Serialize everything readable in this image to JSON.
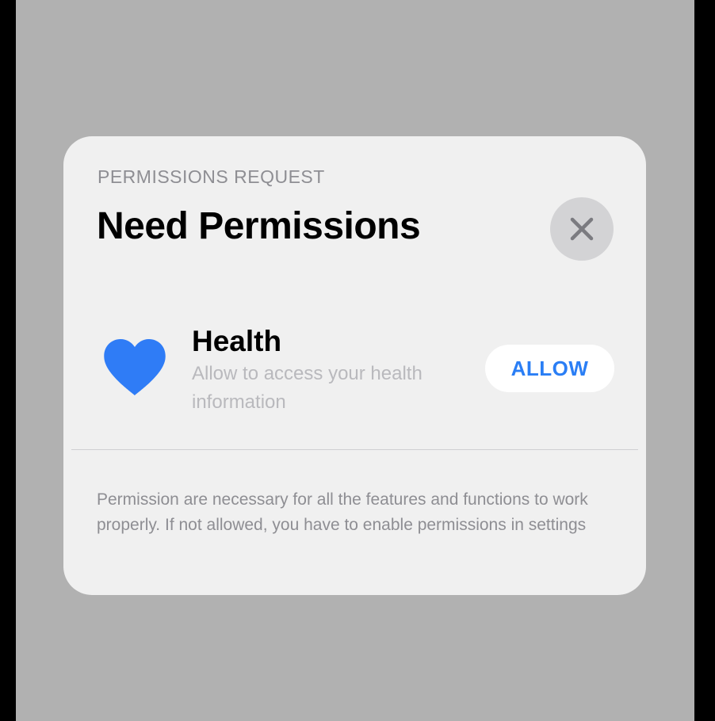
{
  "dialog": {
    "eyebrow": "PERMISSIONS REQUEST",
    "title": "Need Permissions",
    "close_icon": "close-icon"
  },
  "permission": {
    "icon": "heart-icon",
    "icon_color": "#2f7cf6",
    "title": "Health",
    "description": "Allow to access your health information",
    "allow_label": "ALLOW",
    "allow_color": "#2a7ef5"
  },
  "footer": {
    "text": "Permission are necessary for all the features and functions to work properly. If not allowed, you have to enable permissions in settings"
  }
}
